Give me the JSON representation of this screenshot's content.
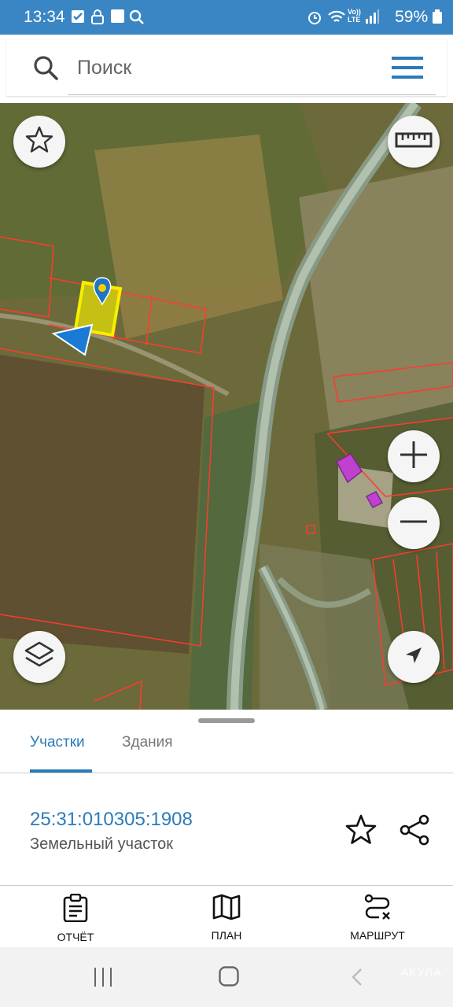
{
  "status_bar": {
    "time": "13:34",
    "network": "Vo))\nLTE",
    "battery": "59%"
  },
  "search": {
    "placeholder": "Поиск"
  },
  "tabs": [
    {
      "label": "Участки",
      "active": true
    },
    {
      "label": "Здания",
      "active": false
    }
  ],
  "parcel": {
    "cadastral_number": "25:31:010305:1908",
    "type": "Земельный участок"
  },
  "actions": [
    {
      "label": "ОТЧЁТ",
      "icon": "report-icon"
    },
    {
      "label": "ПЛАН",
      "icon": "map-plan-icon"
    },
    {
      "label": "МАРШРУТ",
      "icon": "route-icon"
    }
  ],
  "watermark": "АКУЛА",
  "colors": {
    "accent": "#2c7bb8",
    "status_bar": "#3a86c5",
    "parcel_border": "#ff3b2f",
    "selected_parcel": "#f4f000",
    "building": "#c040d0"
  }
}
